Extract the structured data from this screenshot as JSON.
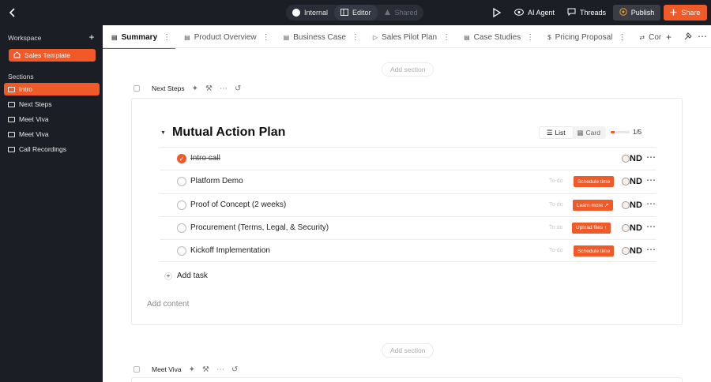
{
  "topbar": {
    "modes": [
      {
        "label": "Internal",
        "icon": "dot-icon"
      },
      {
        "label": "Editor",
        "icon": "editor-icon"
      },
      {
        "label": "Shared",
        "icon": "shared-icon"
      }
    ],
    "ai_agent_label": "AI Agent",
    "threads_label": "Threads",
    "publish_label": "Publish",
    "share_label": "Share"
  },
  "sidebar": {
    "workspace_label": "Workspace",
    "template_label": "Sales Template",
    "sections_label": "Sections",
    "items": [
      {
        "label": "Intro",
        "active": true
      },
      {
        "label": "Next Steps",
        "active": false
      },
      {
        "label": "Meet Viva",
        "active": false
      },
      {
        "label": "Meet Viva",
        "active": false
      },
      {
        "label": "Call Recordings",
        "active": false
      }
    ]
  },
  "tabs": [
    {
      "label": "Summary",
      "icon": "page-icon",
      "active": true
    },
    {
      "label": "Product Overview",
      "icon": "page-icon",
      "active": false
    },
    {
      "label": "Business Case",
      "icon": "page-icon",
      "active": false
    },
    {
      "label": "Sales Pilot Plan",
      "icon": "page-icon",
      "active": false
    },
    {
      "label": "Case Studies",
      "icon": "page-icon",
      "active": false
    },
    {
      "label": "Pricing Proposal",
      "icon": "dollar-icon",
      "active": false
    },
    {
      "label": "Competitor Compa",
      "icon": "page-icon",
      "active": false
    }
  ],
  "main": {
    "add_section_label": "Add section",
    "section1_title": "Next Steps",
    "section2_title": "Meet Viva",
    "map_title": "Mutual Action Plan",
    "view_list_label": "List",
    "view_card_label": "Card",
    "progress_fraction": 0.2,
    "progress_text": "1/5",
    "add_task_label": "Add task",
    "add_content_label": "Add content",
    "tasks": [
      {
        "label": "Intro call",
        "done": true,
        "status": "",
        "cta": "",
        "owner": "ND"
      },
      {
        "label": "Platform Demo",
        "done": false,
        "status": "To-do",
        "cta": "Schedule time",
        "owner": "ND"
      },
      {
        "label": "Proof of Concept (2 weeks)",
        "done": false,
        "status": "To-do",
        "cta": "Learn more ↗",
        "owner": "ND"
      },
      {
        "label": "Procurement (Terms, Legal, & Security)",
        "done": false,
        "status": "To-do",
        "cta": "Upload files ↑",
        "owner": "ND"
      },
      {
        "label": "Kickoff Implementation",
        "done": false,
        "status": "To-do",
        "cta": "Schedule time",
        "owner": "ND"
      }
    ]
  },
  "colors": {
    "accent": "#f05a28",
    "dark": "#1c1e25"
  }
}
